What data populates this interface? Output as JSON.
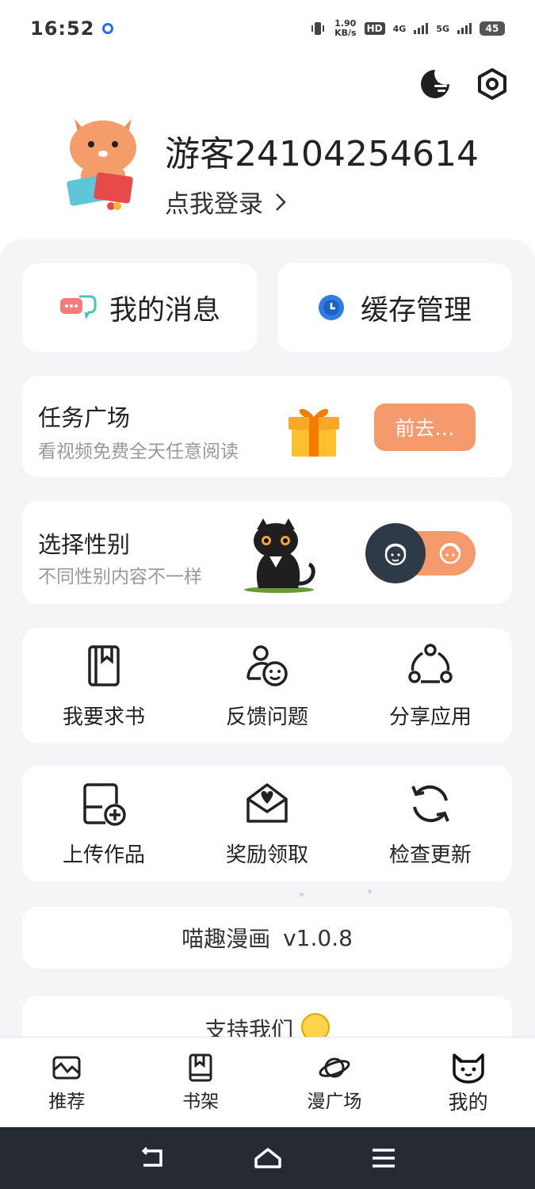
{
  "status_bar": {
    "time": "16:52",
    "net_speed_value": "1.90",
    "net_speed_unit": "KB/s",
    "hd_label": "HD",
    "network_1": "4G",
    "network_2": "5G",
    "battery": "45"
  },
  "header": {
    "icons": [
      "night-mode-icon",
      "settings-icon"
    ]
  },
  "profile": {
    "username": "游客24104254614",
    "login_text": "点我登录"
  },
  "quick_actions": {
    "messages_label": "我的消息",
    "cache_label": "缓存管理"
  },
  "task_square": {
    "title": "任务广场",
    "subtitle": "看视频免费全天任意阅读",
    "button_label": "前去…"
  },
  "gender": {
    "title": "选择性别",
    "subtitle": "不同性别内容不一样",
    "selected": "male"
  },
  "grid_row_1": [
    {
      "label": "我要求书",
      "icon": "book-request-icon"
    },
    {
      "label": "反馈问题",
      "icon": "feedback-icon"
    },
    {
      "label": "分享应用",
      "icon": "share-icon"
    }
  ],
  "grid_row_2": [
    {
      "label": "上传作品",
      "icon": "upload-icon"
    },
    {
      "label": "奖励领取",
      "icon": "reward-icon"
    },
    {
      "label": "检查更新",
      "icon": "refresh-icon"
    }
  ],
  "app_info": {
    "name": "喵趣漫画",
    "version": "v1.0.8"
  },
  "support": {
    "label": "支持我们"
  },
  "tab_bar": {
    "tabs": [
      {
        "label": "推荐",
        "icon": "recommend-icon"
      },
      {
        "label": "书架",
        "icon": "bookshelf-icon"
      },
      {
        "label": "漫广场",
        "icon": "planet-icon"
      },
      {
        "label": "我的",
        "icon": "cat-face-icon"
      }
    ],
    "active_index": 3
  },
  "colors": {
    "accent": "#f59a6c",
    "dark_toggle": "#2e3a48",
    "panel_bg": "#f5f5f7",
    "system_nav_bg": "#262a33"
  }
}
